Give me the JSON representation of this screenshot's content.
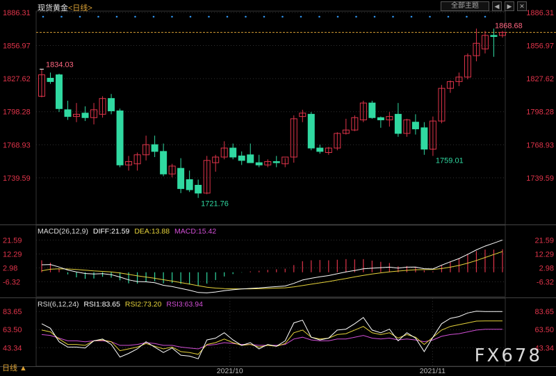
{
  "header": {
    "title": "现货黄金",
    "timeframe": "<日线>",
    "theme_button": "全部主题",
    "prev_button": "◀",
    "next_button": "▶",
    "close_button": "✕"
  },
  "period_label": "日线 ▲",
  "watermark": "FX678",
  "colors": {
    "up": "#e0344a",
    "down": "#30d9a1",
    "background": "#000000",
    "grid": "#333333",
    "price_line": "#d9a035",
    "diff": "#ffffff",
    "dea": "#e6d33b",
    "macd": "#d24fd6",
    "rsi1": "#ffffff",
    "rsi2": "#e6d33b",
    "rsi3": "#d24fd6",
    "axis_text": "#e0344a"
  },
  "chart_data": [
    {
      "type": "candlestick",
      "title": "现货黄金",
      "y_ticks": [
        "1886.31",
        "1856.97",
        "1827.62",
        "1798.28",
        "1768.93",
        "1739.59"
      ],
      "ylim": [
        1700,
        1886.31
      ],
      "x_tick_labels": [
        "2021/10",
        "2021/11"
      ],
      "last_price": "1868.68",
      "annotations": {
        "high_label": "1834.03",
        "low_label": "1721.76",
        "swing_low_label": "1759.01"
      },
      "candles": [
        {
          "o": 1812,
          "h": 1836,
          "l": 1811,
          "c": 1831
        },
        {
          "o": 1828,
          "h": 1833,
          "l": 1823,
          "c": 1825
        },
        {
          "o": 1831,
          "h": 1832,
          "l": 1798,
          "c": 1801
        },
        {
          "o": 1800,
          "h": 1808,
          "l": 1791,
          "c": 1794
        },
        {
          "o": 1794,
          "h": 1806,
          "l": 1789,
          "c": 1796
        },
        {
          "o": 1797,
          "h": 1803,
          "l": 1790,
          "c": 1793
        },
        {
          "o": 1793,
          "h": 1806,
          "l": 1787,
          "c": 1800
        },
        {
          "o": 1796,
          "h": 1812,
          "l": 1793,
          "c": 1810
        },
        {
          "o": 1810,
          "h": 1814,
          "l": 1796,
          "c": 1799
        },
        {
          "o": 1799,
          "h": 1801,
          "l": 1749,
          "c": 1751
        },
        {
          "o": 1751,
          "h": 1759,
          "l": 1746,
          "c": 1754
        },
        {
          "o": 1752,
          "h": 1762,
          "l": 1746,
          "c": 1760
        },
        {
          "o": 1760,
          "h": 1777,
          "l": 1755,
          "c": 1769
        },
        {
          "o": 1769,
          "h": 1777,
          "l": 1758,
          "c": 1763
        },
        {
          "o": 1763,
          "h": 1770,
          "l": 1741,
          "c": 1743
        },
        {
          "o": 1743,
          "h": 1752,
          "l": 1740,
          "c": 1750
        },
        {
          "o": 1748,
          "h": 1757,
          "l": 1726,
          "c": 1730
        },
        {
          "o": 1738,
          "h": 1746,
          "l": 1727,
          "c": 1729
        },
        {
          "o": 1733,
          "h": 1738,
          "l": 1721.76,
          "c": 1726
        },
        {
          "o": 1726,
          "h": 1759,
          "l": 1725,
          "c": 1755
        },
        {
          "o": 1753,
          "h": 1760,
          "l": 1745,
          "c": 1758
        },
        {
          "o": 1758,
          "h": 1772,
          "l": 1756,
          "c": 1766
        },
        {
          "o": 1766,
          "h": 1770,
          "l": 1756,
          "c": 1758
        },
        {
          "o": 1759,
          "h": 1763,
          "l": 1751,
          "c": 1755
        },
        {
          "o": 1760,
          "h": 1770,
          "l": 1753,
          "c": 1753
        },
        {
          "o": 1753,
          "h": 1760,
          "l": 1749,
          "c": 1751
        },
        {
          "o": 1751,
          "h": 1756,
          "l": 1749,
          "c": 1754
        },
        {
          "o": 1754,
          "h": 1759,
          "l": 1749,
          "c": 1753
        },
        {
          "o": 1752,
          "h": 1757,
          "l": 1749,
          "c": 1758
        },
        {
          "o": 1758,
          "h": 1795,
          "l": 1753,
          "c": 1792
        },
        {
          "o": 1794,
          "h": 1800,
          "l": 1789,
          "c": 1797
        },
        {
          "o": 1796,
          "h": 1798,
          "l": 1764,
          "c": 1766
        },
        {
          "o": 1766,
          "h": 1769,
          "l": 1761,
          "c": 1763
        },
        {
          "o": 1762,
          "h": 1767,
          "l": 1760,
          "c": 1766
        },
        {
          "o": 1766,
          "h": 1780,
          "l": 1764,
          "c": 1779
        },
        {
          "o": 1779,
          "h": 1792,
          "l": 1778,
          "c": 1782
        },
        {
          "o": 1782,
          "h": 1795,
          "l": 1781,
          "c": 1793
        },
        {
          "o": 1791,
          "h": 1808,
          "l": 1789,
          "c": 1806
        },
        {
          "o": 1806,
          "h": 1808,
          "l": 1792,
          "c": 1793
        },
        {
          "o": 1793,
          "h": 1794,
          "l": 1784,
          "c": 1791
        },
        {
          "o": 1791,
          "h": 1798,
          "l": 1785,
          "c": 1794
        },
        {
          "o": 1796,
          "h": 1806,
          "l": 1776,
          "c": 1779
        },
        {
          "o": 1779,
          "h": 1792,
          "l": 1776,
          "c": 1791
        },
        {
          "o": 1789,
          "h": 1796,
          "l": 1778,
          "c": 1783
        },
        {
          "o": 1784,
          "h": 1789,
          "l": 1760,
          "c": 1765
        },
        {
          "o": 1765,
          "h": 1794,
          "l": 1759.01,
          "c": 1790
        },
        {
          "o": 1790,
          "h": 1822,
          "l": 1788,
          "c": 1819
        },
        {
          "o": 1819,
          "h": 1826,
          "l": 1815,
          "c": 1825
        },
        {
          "o": 1825,
          "h": 1833,
          "l": 1821,
          "c": 1829
        },
        {
          "o": 1829,
          "h": 1850,
          "l": 1827,
          "c": 1848
        },
        {
          "o": 1848,
          "h": 1872,
          "l": 1843,
          "c": 1859
        },
        {
          "o": 1854,
          "h": 1870,
          "l": 1850,
          "c": 1866
        },
        {
          "o": 1866,
          "h": 1872,
          "l": 1847,
          "c": 1865
        },
        {
          "o": 1866,
          "h": 1870,
          "l": 1864,
          "c": 1868.68
        }
      ]
    },
    {
      "type": "macd",
      "label": "MACD(26,12,9)",
      "diff_text": "DIFF:21.59",
      "dea_text": "DEA:13.88",
      "macd_text": "MACD:15.42",
      "y_ticks": [
        "21.59",
        "12.29",
        "2.98",
        "-6.32"
      ],
      "ylim": [
        -15,
        25
      ],
      "diff": [
        5,
        5.2,
        3.5,
        1.5,
        0.2,
        -0.8,
        -1.2,
        -0.9,
        -1.6,
        -3.2,
        -5.1,
        -6.2,
        -6.4,
        -7,
        -8.7,
        -9.5,
        -10.8,
        -12,
        -13.5,
        -13.8,
        -13.2,
        -12.3,
        -11.7,
        -11.2,
        -10.8,
        -10.5,
        -10,
        -9.6,
        -9.2,
        -7.4,
        -5.2,
        -4,
        -3,
        -2.2,
        -1,
        0.2,
        1.2,
        2.3,
        2.7,
        3.1,
        3.4,
        2.8,
        3.4,
        3.5,
        2.4,
        2.2,
        4.7,
        7,
        9.2,
        12,
        15,
        17.5,
        19.5,
        21.59
      ],
      "dea": [
        1,
        2,
        2.3,
        2.2,
        1.9,
        1.4,
        0.9,
        0.6,
        0.2,
        -0.5,
        -1.4,
        -2.4,
        -3.2,
        -4,
        -5,
        -5.9,
        -6.9,
        -7.9,
        -9,
        -10,
        -10.6,
        -10.9,
        -11.1,
        -11.1,
        -11.1,
        -11,
        -10.8,
        -10.6,
        -10.4,
        -9.8,
        -8.9,
        -8,
        -7.1,
        -6.2,
        -5.2,
        -4.2,
        -3.1,
        -2.1,
        -1.2,
        -0.4,
        0.3,
        0.8,
        1.3,
        1.7,
        1.8,
        1.9,
        2.5,
        3.4,
        4.6,
        6.1,
        7.9,
        9.9,
        11.9,
        13.88
      ],
      "macd": [
        8,
        6.4,
        2.4,
        -1.4,
        -3.4,
        -4.4,
        -4.2,
        -3,
        -3.6,
        -5.4,
        -7.4,
        -7.6,
        -6.4,
        -6,
        -7.4,
        -7.2,
        -7.8,
        -8.2,
        -9,
        -7.6,
        -5.2,
        -2.8,
        -1.2,
        -0.2,
        0.6,
        1,
        1.6,
        2,
        2.4,
        4.8,
        7.4,
        8,
        8.2,
        8,
        8.4,
        8.8,
        8.6,
        8.8,
        7.8,
        7,
        6.2,
        4,
        4.2,
        3.6,
        1.2,
        0.6,
        4.4,
        7.2,
        9.2,
        11.8,
        14.2,
        15.2,
        15.2,
        15.42
      ]
    },
    {
      "type": "rsi",
      "label": "RSI(6,12,24)",
      "rsi1_text": "RSI1:83.65",
      "rsi2_text": "RSI2:73.20",
      "rsi3_text": "RSI3:63.94",
      "y_ticks": [
        "83.65",
        "63.50",
        "43.34"
      ],
      "ylim": [
        25,
        90
      ],
      "rsi1": [
        70,
        65,
        50,
        44,
        44,
        43,
        51,
        53,
        47,
        33,
        37,
        42,
        50,
        44,
        38,
        43,
        35,
        34,
        31,
        52,
        54,
        60,
        52,
        46,
        49,
        42,
        47,
        45,
        51,
        71,
        74,
        55,
        52,
        54,
        63,
        64,
        70,
        77,
        63,
        60,
        64,
        51,
        60,
        54,
        39,
        55,
        70,
        76,
        78,
        82,
        84,
        83.65,
        83.65,
        83.65
      ],
      "rsi2": [
        63,
        61,
        53,
        47,
        47,
        46,
        51,
        52,
        50,
        40,
        42,
        44,
        48,
        45,
        42,
        44,
        39,
        38,
        36,
        47,
        49,
        53,
        49,
        46,
        47,
        44,
        46,
        45,
        48,
        60,
        63,
        55,
        53,
        54,
        58,
        59,
        63,
        67,
        60,
        58,
        60,
        54,
        58,
        55,
        47,
        55,
        63,
        67,
        69,
        71,
        73,
        73.2,
        73.2,
        73.2
      ],
      "rsi3": [
        58,
        57,
        54,
        51,
        51,
        50,
        51,
        51,
        50,
        46,
        46,
        47,
        49,
        48,
        46,
        46,
        44,
        43,
        42,
        46,
        47,
        49,
        48,
        47,
        47,
        46,
        46,
        46,
        47,
        53,
        55,
        52,
        51,
        51,
        53,
        53,
        55,
        57,
        54,
        53,
        54,
        52,
        53,
        52,
        50,
        52,
        56,
        58,
        59,
        61,
        63,
        63.94,
        63.94,
        63.94
      ]
    }
  ]
}
